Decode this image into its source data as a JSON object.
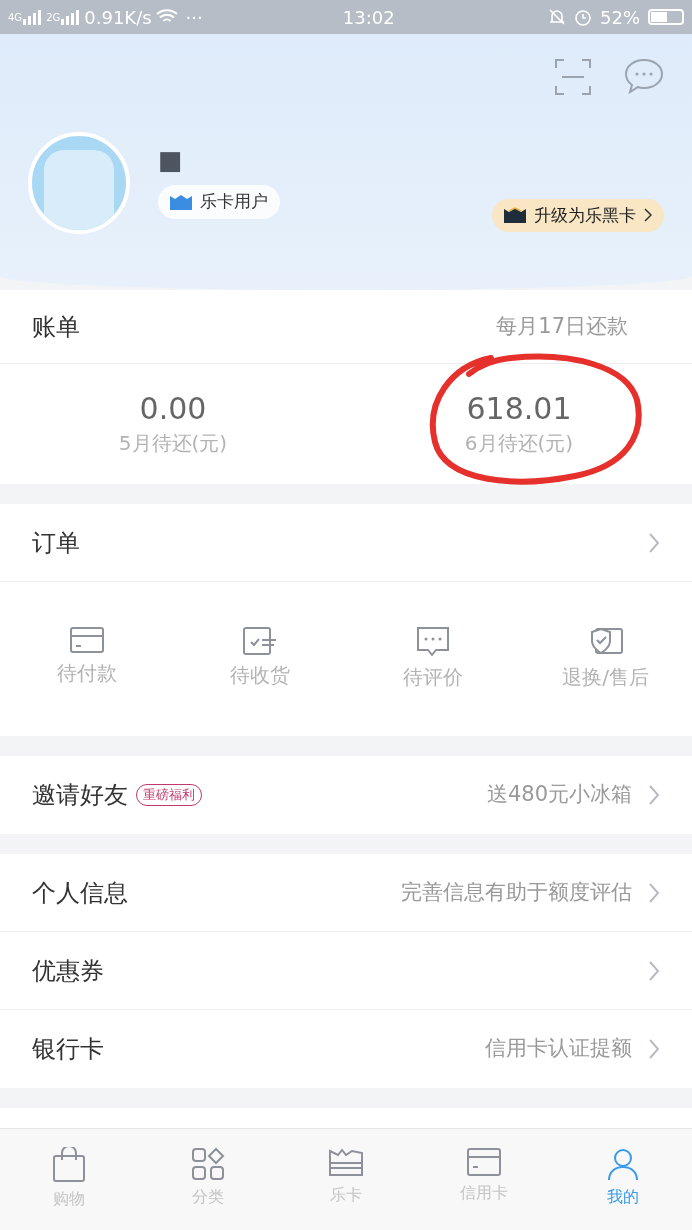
{
  "status_bar": {
    "network_1": "4G",
    "network_2": "2G",
    "speed": "0.91K/s",
    "more": "···",
    "time": "13:02",
    "battery": "52%"
  },
  "profile": {
    "name": "■",
    "badge": "乐卡用户",
    "upgrade": "升级为乐黑卡"
  },
  "bill": {
    "title": "账单",
    "note": "每月17日还款",
    "amounts": [
      {
        "value": "0.00",
        "label": "5月待还(元)"
      },
      {
        "value": "618.01",
        "label": "6月待还(元)",
        "circled": true
      }
    ]
  },
  "orders": {
    "title": "订单",
    "items": [
      {
        "kind": "pay",
        "label": "待付款"
      },
      {
        "kind": "receive",
        "label": "待收货"
      },
      {
        "kind": "review",
        "label": "待评价"
      },
      {
        "kind": "refund",
        "label": "退换/售后"
      }
    ]
  },
  "invite": {
    "title": "邀请好友",
    "tag": "重磅福利",
    "value": "送480元小冰箱"
  },
  "menu": [
    {
      "title": "个人信息",
      "value": "完善信息有助于额度评估"
    },
    {
      "title": "优惠券"
    },
    {
      "title": "银行卡",
      "value": "信用卡认证提额"
    }
  ],
  "tab_bar": [
    {
      "kind": "bag",
      "label": "购物",
      "selected": false
    },
    {
      "kind": "grid",
      "label": "分类",
      "selected": false
    },
    {
      "kind": "card",
      "label": "乐卡",
      "selected": false
    },
    {
      "kind": "credit",
      "label": "信用卡",
      "selected": false
    },
    {
      "kind": "me",
      "label": "我的",
      "selected": true
    }
  ]
}
